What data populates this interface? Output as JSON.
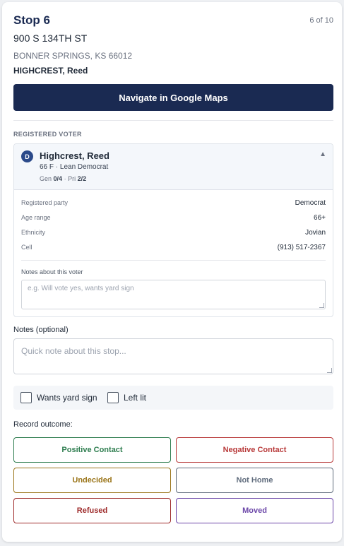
{
  "header": {
    "stop_title": "Stop 6",
    "counter": "6 of 10",
    "address_line1": "900 S 134TH ST",
    "address_line2": "BONNER SPRINGS, KS 66012",
    "resident": "HIGHCREST, Reed"
  },
  "navigate_button": {
    "label": "Navigate in Google Maps"
  },
  "registered_voter": {
    "section_label": "REGISTERED VOTER",
    "party_badge": "D",
    "name": "Highcrest, Reed",
    "meta": "66 F · Lean Democrat",
    "history": {
      "gen_label": "Gen",
      "gen_value": "0/4",
      "separator": "·",
      "pri_label": "Pri",
      "pri_value": "2/2"
    },
    "collapse_icon": "▲",
    "details": [
      {
        "label": "Registered party",
        "value": "Democrat"
      },
      {
        "label": "Age range",
        "value": "66+"
      },
      {
        "label": "Ethnicity",
        "value": "Jovian"
      },
      {
        "label": "Cell",
        "value": "(913) 517-2367"
      }
    ],
    "notes_label": "Notes about this voter",
    "notes_placeholder": "e.g. Will vote yes, wants yard sign",
    "notes_value": ""
  },
  "stop_notes": {
    "label": "Notes (optional)",
    "placeholder": "Quick note about this stop...",
    "value": ""
  },
  "checkboxes": [
    {
      "label": "Wants yard sign",
      "checked": false
    },
    {
      "label": "Left lit",
      "checked": false
    }
  ],
  "outcome": {
    "label": "Record outcome:",
    "buttons": [
      {
        "label": "Positive Contact",
        "color": "#2e7d4f"
      },
      {
        "label": "Negative Contact",
        "color": "#b83a3a"
      },
      {
        "label": "Undecided",
        "color": "#9a7418"
      },
      {
        "label": "Not Home",
        "color": "#5f6b7c"
      },
      {
        "label": "Refused",
        "color": "#9e2b2b"
      },
      {
        "label": "Moved",
        "color": "#6b46a8"
      }
    ]
  },
  "colors": {
    "primary": "#1a2a52",
    "party_badge": "#2b4a8a"
  }
}
